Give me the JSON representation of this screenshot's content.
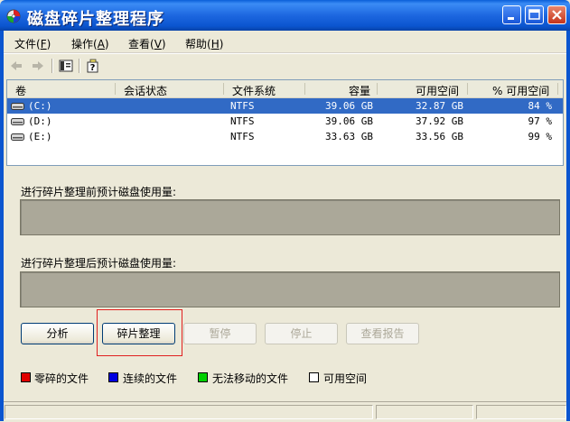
{
  "window": {
    "title": "磁盘碎片整理程序",
    "icon": "defrag-app-icon"
  },
  "menu": [
    {
      "label": "文件",
      "key": "F"
    },
    {
      "label": "操作",
      "key": "A"
    },
    {
      "label": "查看",
      "key": "V"
    },
    {
      "label": "帮助",
      "key": "H"
    }
  ],
  "toolbar": {
    "icons": [
      "back-arrow-icon",
      "forward-arrow-icon",
      "console-tree-icon",
      "help-properties-icon"
    ]
  },
  "volumes": {
    "headers": [
      "卷",
      "会话状态",
      "文件系统",
      "容量",
      "可用空间",
      "% 可用空间"
    ],
    "rows": [
      {
        "name": "(C:)",
        "session": "",
        "fs": "NTFS",
        "capacity": "39.06 GB",
        "free": "32.87 GB",
        "pct": "84 %",
        "selected": true
      },
      {
        "name": "(D:)",
        "session": "",
        "fs": "NTFS",
        "capacity": "39.06 GB",
        "free": "37.92 GB",
        "pct": "97 %",
        "selected": false
      },
      {
        "name": "(E:)",
        "session": "",
        "fs": "NTFS",
        "capacity": "33.63 GB",
        "free": "33.56 GB",
        "pct": "99 %",
        "selected": false
      }
    ]
  },
  "before_label": "进行碎片整理前预计磁盘使用量:",
  "after_label": "进行碎片整理后预计磁盘使用量:",
  "buttons": {
    "analyze": "分析",
    "defragment": "碎片整理",
    "pause": "暂停",
    "stop": "停止",
    "report": "查看报告"
  },
  "legend": [
    {
      "label": "零碎的文件",
      "color": "#e00000"
    },
    {
      "label": "连续的文件",
      "color": "#0000e0"
    },
    {
      "label": "无法移动的文件",
      "color": "#00d000"
    },
    {
      "label": "可用空间",
      "color": "#ffffff"
    }
  ]
}
